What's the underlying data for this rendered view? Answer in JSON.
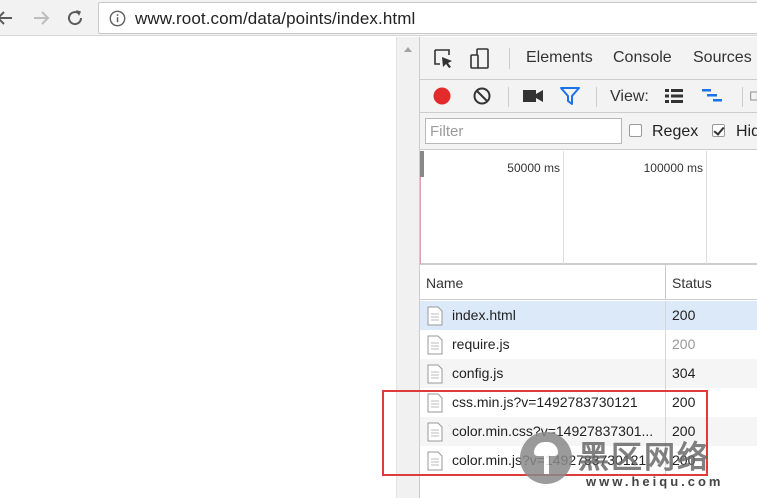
{
  "browser": {
    "url": "www.root.com/data/points/index.html"
  },
  "devtools": {
    "tabs": [
      "Elements",
      "Console",
      "Sources"
    ],
    "view_label": "View:",
    "filter": {
      "placeholder": "Filter",
      "value": ""
    },
    "regex_label": "Regex",
    "regex_checked": false,
    "hide_label": "Hid",
    "hide_checked": true,
    "timeline": {
      "labels": [
        "50000 ms",
        "100000 ms"
      ]
    },
    "table": {
      "columns": [
        "Name",
        "Status"
      ],
      "rows": [
        {
          "name": "index.html",
          "status": "200"
        },
        {
          "name": "require.js",
          "status": "200"
        },
        {
          "name": "config.js",
          "status": "304"
        },
        {
          "name": "css.min.js?v=1492783730121",
          "status": "200"
        },
        {
          "name": "color.min.css?v=14927837301...",
          "status": "200"
        },
        {
          "name": "color.min.js?v=1492783730121",
          "status": "200"
        }
      ]
    }
  },
  "watermark": {
    "brand_cn": "黑区网络",
    "brand_url": "www.heiqu.com"
  },
  "colors": {
    "record": "#e32b2b",
    "filter_funnel": "#1a73e8",
    "selected_row": "#dbe9f8",
    "annotation_box": "#e03b3b"
  }
}
